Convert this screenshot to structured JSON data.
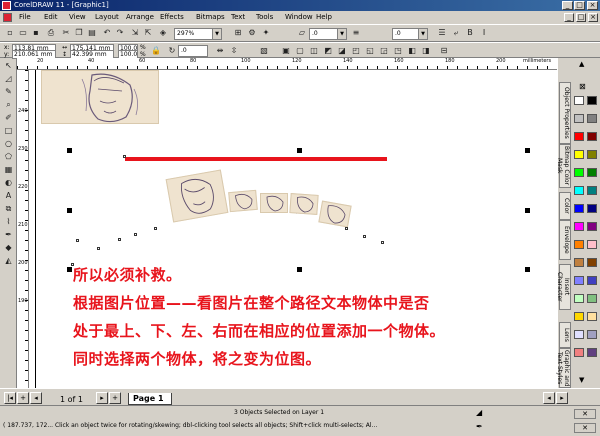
{
  "window": {
    "title": "CorelDRAW 11 - [Graphic1]",
    "min_label": "_",
    "max_label": "□",
    "close_label": "×"
  },
  "menu": {
    "items": [
      "File",
      "Edit",
      "View",
      "Layout",
      "Arrange",
      "Effects",
      "Bitmaps",
      "Text",
      "Tools",
      "Window",
      "Help"
    ]
  },
  "standard_toolbar": {
    "zoom_value": "297%"
  },
  "property_bar": {
    "x": "113.81 mm",
    "y": "210.061 mm",
    "width": "175.141 mm",
    "height": "42.399 mm",
    "scale_x": "100.0",
    "scale_y": "100.0",
    "percent": "%",
    "rotation": ".0",
    "outline_value": ".0",
    "offset_value": ".0"
  },
  "ruler": {
    "unit_top": "millimeters",
    "unit_left": "millimeters",
    "top_ticks": [
      "20",
      "40",
      "60",
      "80",
      "100",
      "120",
      "140",
      "160",
      "180",
      "200"
    ],
    "left_ticks": [
      "240",
      "230",
      "220",
      "210",
      "200",
      "190"
    ]
  },
  "canvas": {
    "lines": [
      "所以必须补救。",
      "根据图片位置——看图片在整个路径文本物体中是否",
      "处于最上、下、左、右而在相应的位置添加一个物体。",
      "同时选择两个物体，将之变为位图。"
    ],
    "red_line_color": "#e8141c"
  },
  "dockers": {
    "tabs": [
      "Object Properties",
      "Bitmap Color Mask",
      "Color",
      "Envelope",
      "Insert Character",
      "Lens",
      "Graphic and Text Styles"
    ]
  },
  "palette": {
    "colors": [
      "#ffffff",
      "#000000",
      "#c0c0c0",
      "#808080",
      "#ff0000",
      "#800000",
      "#ffff00",
      "#808000",
      "#00ff00",
      "#008000",
      "#00ffff",
      "#008080",
      "#0000ff",
      "#000080",
      "#ff00ff",
      "#800080",
      "#ff8000",
      "#ffc0cb",
      "#c08040",
      "#804000",
      "#8080ff",
      "#4040c0",
      "#c0ffc0",
      "#80c080",
      "#ffd700",
      "#ffe0a0",
      "#e0e0ff",
      "#a0a0c0",
      "#f08080",
      "#604080"
    ]
  },
  "page_nav": {
    "counter": "1 of 1",
    "page_tab": "Page 1",
    "first": "|◂",
    "prev": "◂",
    "next": "▸",
    "last": "▸|",
    "add": "+"
  },
  "status": {
    "selection": "3 Objects Selected on Layer 1",
    "hint": "( 187.737, 172... Click an object twice for rotating/skewing; dbl-clicking tool selects all objects; Shift+click multi-selects; Al..."
  }
}
